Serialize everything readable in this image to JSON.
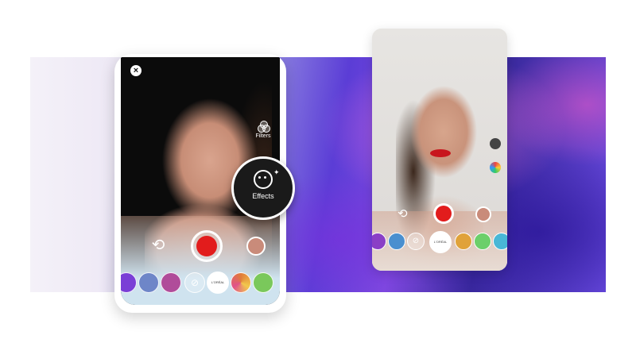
{
  "phone_main": {
    "close_glyph": "×",
    "filters_label": "Filters",
    "effects_label": "Effects",
    "flip_glyph": "⟲",
    "effects_chips": [
      {
        "icon": "lips-purple-icon",
        "color": "#7a3fd6"
      },
      {
        "icon": "lips-blue-icon",
        "color": "#6e86c8"
      },
      {
        "icon": "lips-pink-icon",
        "color": "#b04c9a"
      },
      {
        "icon": "none-icon",
        "glyph": "⊘"
      },
      {
        "icon": "lips-red-icon",
        "label": "L'ORÉAL"
      },
      {
        "icon": "lips-multicolor-icon",
        "color": "#e07c3a"
      },
      {
        "icon": "lips-green-icon",
        "color": "#7ac85b"
      }
    ]
  },
  "phone_second": {
    "flip_glyph": "⟲",
    "effects_chips": [
      {
        "icon": "lips-purple-icon",
        "color": "#8a3fc6"
      },
      {
        "icon": "lips-blue-icon",
        "color": "#4a8fcf"
      },
      {
        "icon": "none-icon",
        "glyph": "⊘"
      },
      {
        "icon": "lips-red-icon",
        "label": "L'ORÉAL"
      },
      {
        "icon": "lips-multicolor-icon",
        "color": "#e0a23a"
      },
      {
        "icon": "lips-green-icon",
        "color": "#6ccf6a"
      },
      {
        "icon": "lips-rainbow-icon",
        "color": "#49b7d6"
      }
    ]
  },
  "colors": {
    "record": "#e21c1c",
    "accent_purple": "#5b3dd6"
  }
}
